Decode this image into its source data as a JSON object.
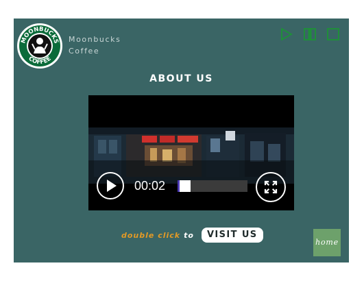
{
  "brand": {
    "logo_text_top": "MOONBUCKS",
    "logo_text_bottom": "COFFEE",
    "name_line1": "Moonbucks",
    "name_line2": "Coffee",
    "logo_icon": "siren-logo-icon",
    "colors": {
      "panel": "#3a6565",
      "logo_ring": "#0b6b3a",
      "media_green": "#1f8f3a"
    }
  },
  "media_controls": [
    {
      "name": "play-icon",
      "label": "play"
    },
    {
      "name": "pause-icon",
      "label": "pause"
    },
    {
      "name": "stop-icon",
      "label": "stop"
    }
  ],
  "heading": "ABOUT US",
  "video": {
    "time": "00:02",
    "progress": 0.19,
    "play_icon": "play-icon",
    "fullscreen_icon": "fullscreen-icon"
  },
  "cta": {
    "hint": "double click",
    "connector": "to",
    "button_label": "VISIT US",
    "hint_color": "#e39a26"
  },
  "home": {
    "label": "home",
    "color": "#6da16b"
  }
}
